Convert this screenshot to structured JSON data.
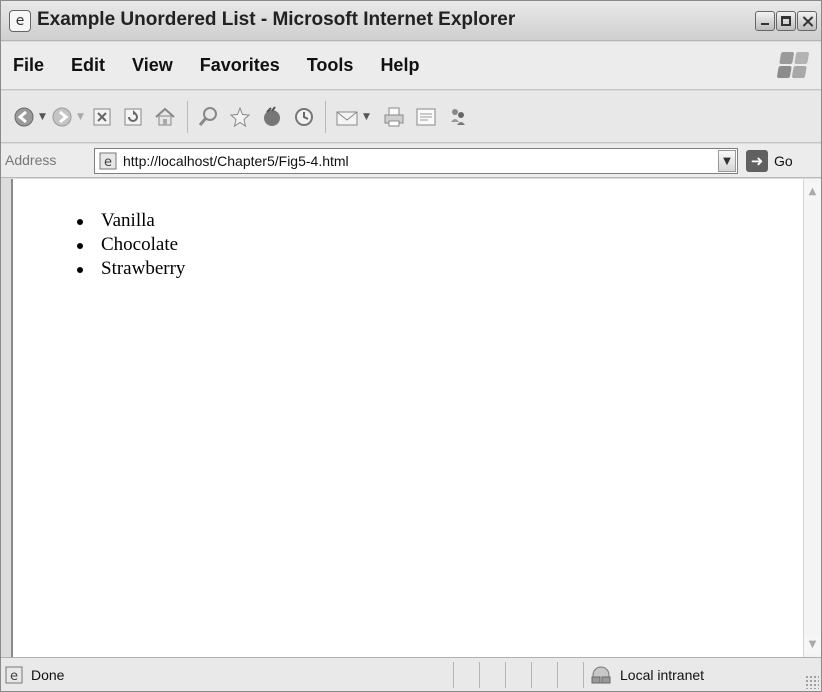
{
  "window": {
    "title": "Example Unordered List - Microsoft Internet Explorer"
  },
  "menu": {
    "items": [
      "File",
      "Edit",
      "View",
      "Favorites",
      "Tools",
      "Help"
    ]
  },
  "toolbar": {
    "icons": [
      "back-icon",
      "forward-icon",
      "stop-icon",
      "refresh-icon",
      "home-icon",
      "search-icon",
      "favorites-icon",
      "media-icon",
      "history-icon",
      "mail-icon",
      "print-icon",
      "edit-icon",
      "messenger-icon"
    ]
  },
  "address": {
    "label": "Address",
    "url": "http://localhost/Chapter5/Fig5-4.html",
    "go_label": "Go"
  },
  "content": {
    "list_items": [
      "Vanilla",
      "Chocolate",
      "Strawberry"
    ]
  },
  "status": {
    "text": "Done",
    "zone": "Local intranet"
  }
}
